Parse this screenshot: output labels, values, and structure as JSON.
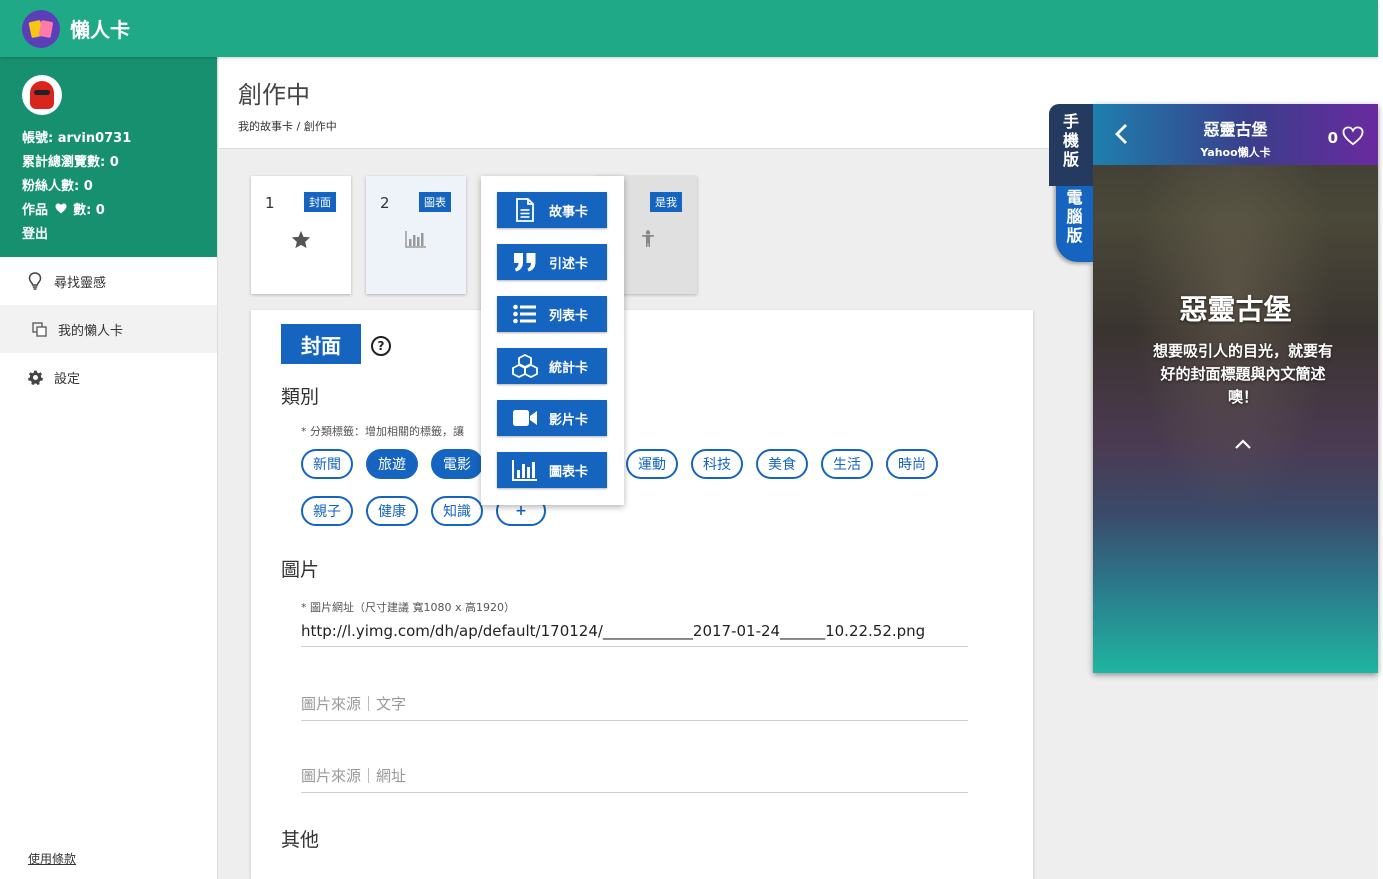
{
  "app": {
    "title": "懶人卡"
  },
  "profile": {
    "account": "帳號: arvin0731",
    "views": "累計總瀏覽數: 0",
    "fans": "粉絲人數: 0",
    "likes_prefix": "作品",
    "likes_suffix": "數: 0",
    "logout": "登出"
  },
  "sidebar": {
    "items": [
      {
        "label": "尋找靈感",
        "icon": "lightbulb-icon"
      },
      {
        "label": "我的懶人卡",
        "icon": "copy-icon"
      },
      {
        "label": "設定",
        "icon": "gear-icon"
      }
    ],
    "terms": "使用條款"
  },
  "header": {
    "title": "創作中",
    "breadcrumb": "我的故事卡 / 創作中"
  },
  "cards": [
    {
      "num": "1",
      "badge": "封面",
      "icon": "star-icon"
    },
    {
      "num": "2",
      "badge": "圖表",
      "icon": "bar-chart-icon"
    },
    {
      "badge": "是我",
      "icon": "person-icon"
    }
  ],
  "dropdown": [
    {
      "label": "故事卡",
      "icon": "document-icon"
    },
    {
      "label": "引述卡",
      "icon": "quote-icon"
    },
    {
      "label": "列表卡",
      "icon": "list-icon"
    },
    {
      "label": "統計卡",
      "icon": "cubes-icon"
    },
    {
      "label": "影片卡",
      "icon": "video-icon"
    },
    {
      "label": "圖表卡",
      "icon": "bar-chart-icon"
    }
  ],
  "editor": {
    "section": "封面",
    "category_heading": "類別",
    "category_hint": "* 分類標籤：增加相關的標籤，讓",
    "chips_row1": [
      {
        "label": "新聞",
        "selected": false
      },
      {
        "label": "旅遊",
        "selected": true
      },
      {
        "label": "電影",
        "selected": true
      },
      {
        "label": "運動",
        "selected": false
      },
      {
        "label": "科技",
        "selected": false
      },
      {
        "label": "美食",
        "selected": false
      },
      {
        "label": "生活",
        "selected": false
      },
      {
        "label": "時尚",
        "selected": false
      }
    ],
    "chips_row2": [
      {
        "label": "親子",
        "selected": false
      },
      {
        "label": "健康",
        "selected": false
      },
      {
        "label": "知識",
        "selected": false
      }
    ],
    "add_chip": "+",
    "image_heading": "圖片",
    "image_hint": "* 圖片網址（尺寸建議 寬1080 x 高1920）",
    "image_url": "http://l.yimg.com/dh/ap/default/170124/____________2017-01-24______10.22.52.png",
    "source_text_placeholder": "圖片來源｜文字",
    "source_url_placeholder": "圖片來源｜網址",
    "other_heading": "其他"
  },
  "preview": {
    "tab_mobile": "手機版",
    "tab_desktop": "電腦版",
    "title": "惡靈古堡",
    "subtitle": "Yahoo懶人卡",
    "likes": "0",
    "big_title": "惡靈古堡",
    "description": "想要吸引人的目光，就要有好的封面標題與內文簡述噢！"
  },
  "colors": {
    "topbar": "#1fa987",
    "profile": "#17906f",
    "primary": "#1565c0"
  }
}
